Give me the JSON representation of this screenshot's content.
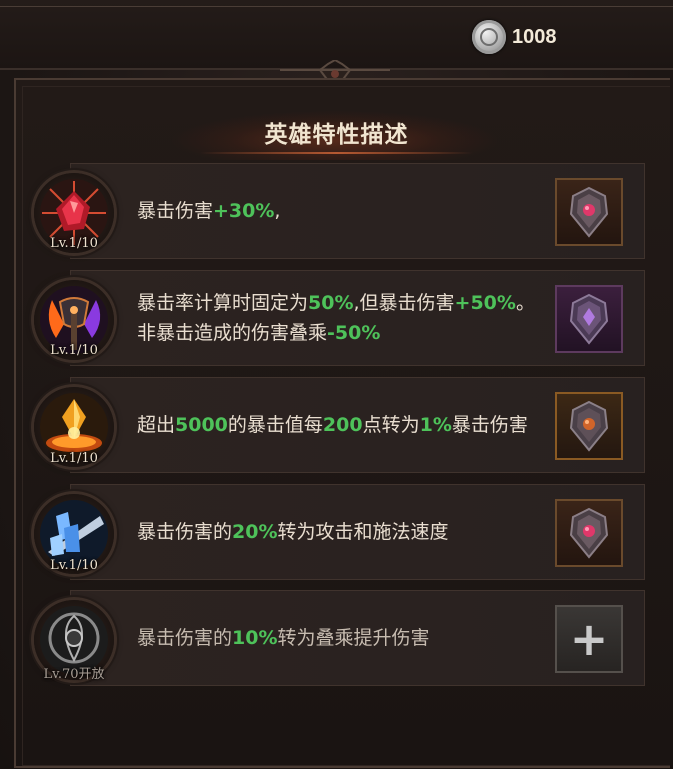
{
  "currency": {
    "icon": "silver-coin-icon",
    "value": "1008"
  },
  "title": "英雄特性描述",
  "traits": [
    {
      "level": "Lv.1/10",
      "icon": "shattered-crystal-icon",
      "segments": [
        {
          "text": "暴击伤害",
          "hl": false
        },
        {
          "text": "+30%",
          "hl": true
        },
        {
          "text": ",",
          "hl": false
        }
      ],
      "gem": "red-shield-gem-icon",
      "slot_style": "bronze"
    },
    {
      "level": "Lv.1/10",
      "icon": "flaming-axe-icon",
      "segments": [
        {
          "text": "暴击率计算时固定为",
          "hl": false
        },
        {
          "text": "50%",
          "hl": true
        },
        {
          "text": ",但暴击伤害",
          "hl": false
        },
        {
          "text": "+50%",
          "hl": true
        },
        {
          "text": "。非暴击造成的伤害叠乘",
          "hl": false
        },
        {
          "text": "-50%",
          "hl": true
        }
      ],
      "gem": "purple-shield-gem-icon",
      "slot_style": "purple"
    },
    {
      "level": "Lv.1/10",
      "icon": "golden-crystal-icon",
      "segments": [
        {
          "text": "超出",
          "hl": false
        },
        {
          "text": "5000",
          "hl": true
        },
        {
          "text": "的暴击值每",
          "hl": false
        },
        {
          "text": "200",
          "hl": true
        },
        {
          "text": "点转为",
          "hl": false
        },
        {
          "text": "1%",
          "hl": true
        },
        {
          "text": "暴击伤害",
          "hl": false
        }
      ],
      "gem": "amber-shield-gem-icon",
      "slot_style": "gold"
    },
    {
      "level": "Lv.1/10",
      "icon": "ice-shard-icon",
      "segments": [
        {
          "text": "暴击伤害的",
          "hl": false
        },
        {
          "text": "20%",
          "hl": true
        },
        {
          "text": "转为攻击和施法速度",
          "hl": false
        }
      ],
      "gem": "red-shield-gem-icon",
      "slot_style": "bronze"
    },
    {
      "level": "Lv.70开放",
      "icon": "locked-sigil-icon",
      "segments": [
        {
          "text": "暴击伤害的",
          "hl": false
        },
        {
          "text": "10%",
          "hl": true
        },
        {
          "text": "转为叠乘提升伤害",
          "hl": false
        }
      ],
      "gem": "plus-icon",
      "slot_style": "empty",
      "locked": true
    }
  ],
  "colors": {
    "highlight": "#4ec25a",
    "text": "#e9ded0",
    "title": "#f1e5d0"
  }
}
